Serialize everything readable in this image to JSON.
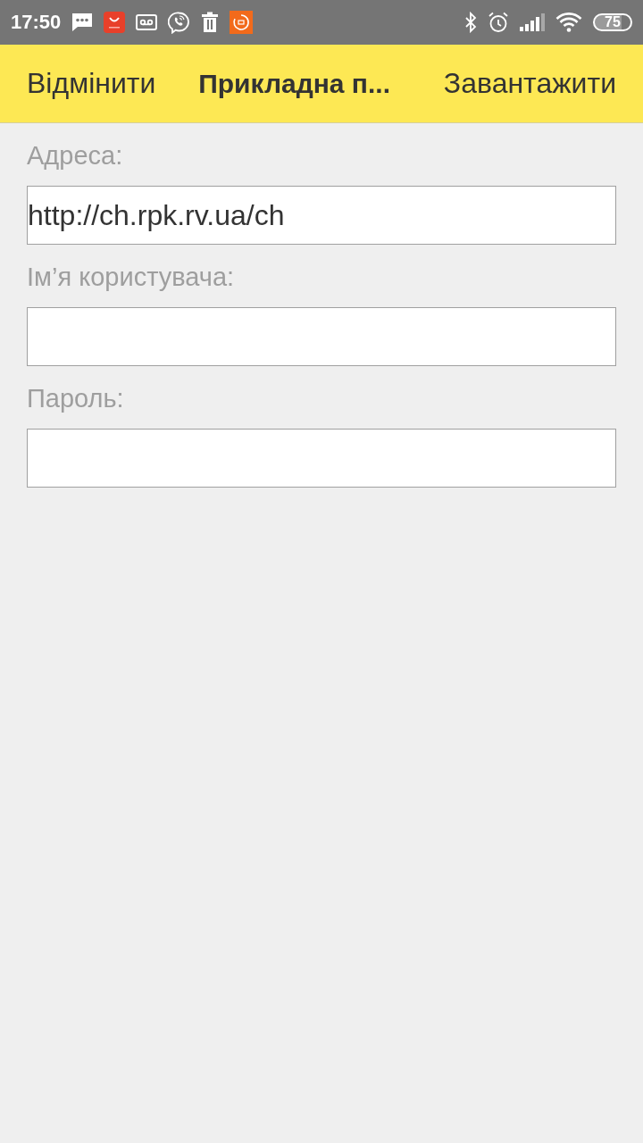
{
  "status_bar": {
    "time": "17:50",
    "battery": "75"
  },
  "toolbar": {
    "cancel_button": "Відмінити",
    "title": "Прикладна п...",
    "download_button": "Завантажити"
  },
  "form": {
    "fields": [
      {
        "label": "Адреса:",
        "value": "http://ch.rpk.rv.ua/ch"
      },
      {
        "label": "Ім’я користувача:"
      },
      {
        "label": "Пароль:"
      }
    ]
  }
}
